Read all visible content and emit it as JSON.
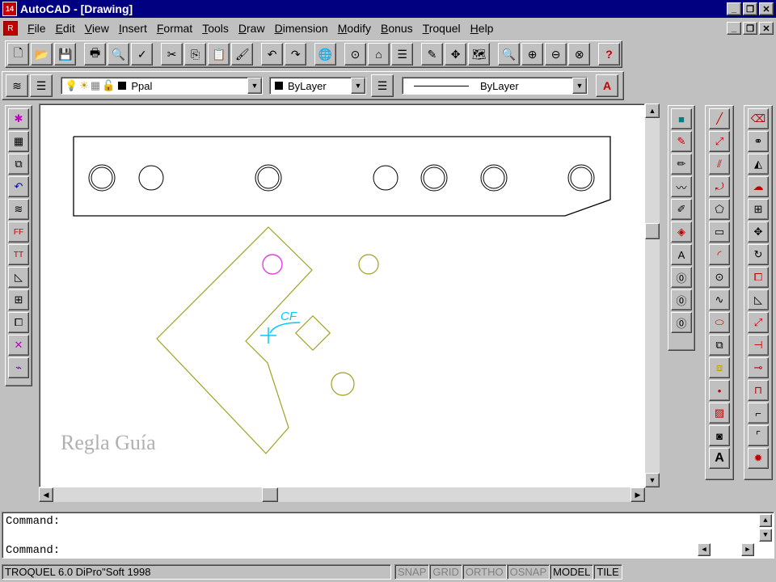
{
  "app": {
    "title": "AutoCAD - [Drawing]",
    "app_icon_text": "14",
    "doc_icon_text": "R"
  },
  "menu": [
    "File",
    "Edit",
    "View",
    "Insert",
    "Format",
    "Tools",
    "Draw",
    "Dimension",
    "Modify",
    "Bonus",
    "Troquel",
    "Help"
  ],
  "properties": {
    "layer": "Ppal",
    "color": "ByLayer",
    "linetype": "ByLayer"
  },
  "drawing": {
    "label_cf": "CF",
    "regla_text": "Regla Guía",
    "colors": {
      "part": "#000000",
      "template": "#a0a020",
      "magenta": "#e040e0",
      "cyan": "#00c8ff"
    }
  },
  "command": {
    "line1": "Command:",
    "line2": "Command:"
  },
  "status": {
    "left": "TROQUEL 6.0 DiPro\"Soft 1998",
    "snap": "SNAP",
    "grid": "GRID",
    "ortho": "ORTHO",
    "osnap": "OSNAP",
    "model": "MODEL",
    "tile": "TILE"
  }
}
